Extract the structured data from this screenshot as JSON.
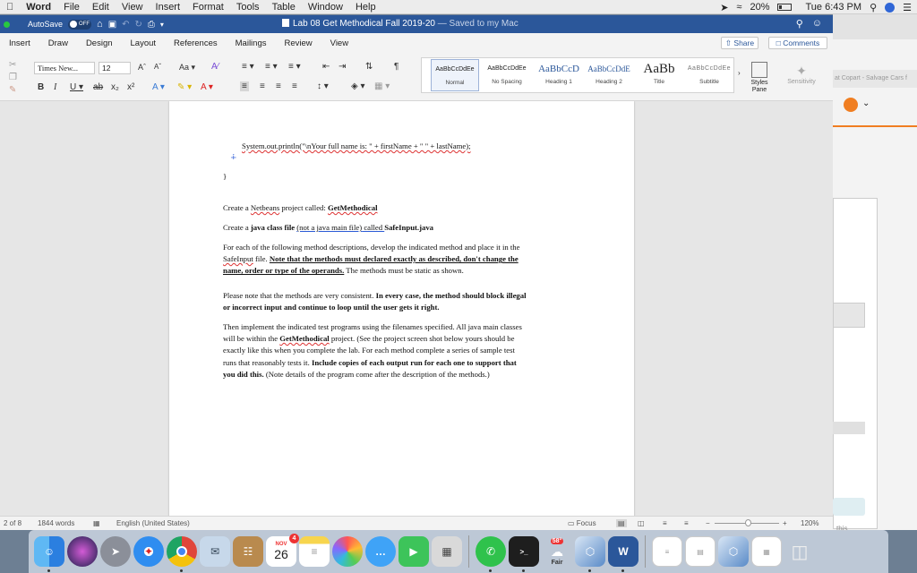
{
  "menubar": {
    "apple_icon": "apple-icon",
    "items": [
      "Word",
      "File",
      "Edit",
      "View",
      "Insert",
      "Format",
      "Tools",
      "Table",
      "Window",
      "Help"
    ],
    "battery": "20%",
    "clock": "Tue 6:43 PM"
  },
  "background_window": {
    "url_text": "at Copart - Salvage Cars f",
    "footer_text": "this"
  },
  "titlebar": {
    "autosave_label": "AutoSave",
    "autosave_state": "OFF",
    "doc_title": "Lab 08 Get Methodical Fall 2019-20",
    "saved_status": "— Saved to my Mac"
  },
  "tabs": [
    "Insert",
    "Draw",
    "Design",
    "Layout",
    "References",
    "Mailings",
    "Review",
    "View"
  ],
  "share_label": "Share",
  "comments_label": "Comments",
  "ribbon": {
    "font_name": "Times New...",
    "font_size": "12",
    "styles": [
      {
        "preview": "AaBbCcDdEe",
        "name": "Normal"
      },
      {
        "preview": "AaBbCcDdEe",
        "name": "No Spacing"
      },
      {
        "preview": "AaBbCcD",
        "name": "Heading 1"
      },
      {
        "preview": "AaBbCcDdE",
        "name": "Heading 2"
      },
      {
        "preview": "AaBb",
        "name": "Title"
      },
      {
        "preview": "AaBbCcDdEe",
        "name": "Subtitle"
      }
    ],
    "styles_pane_label": "Styles Pane",
    "sensitivity_label": "Sensitivity"
  },
  "document": {
    "code_line": "System.out.println(\"\\nYour full name is: \" + firstName + \" \" + lastName);",
    "brace": "}",
    "para1": {
      "pre": "Create a ",
      "netbeans": "Netbeans",
      " mid": " project called: ",
      "name": "GetMethodical"
    },
    "para2": {
      "pre": "Create a ",
      "java_class": "java class file",
      "space": " ",
      "paren": "(not a java main file)",
      "called": " called ",
      "file": "SafeInput.java"
    },
    "para3": {
      "l1": "For each of the following method descriptions, develop the indicated method and place it in the",
      "l2a": "SafeInput",
      "l2b": " file.  ",
      "l2c": "Note that the methods must declared exactly as described, don't change the",
      "l3a": "name, order or type of the operands.",
      "l3b": "  The methods must be static as shown."
    },
    "para4": {
      "l1a": "Please note that the methods are very consistent. ",
      "l1b": "In every case, the method should block illegal",
      "l2": "or incorrect input and continue to loop until the user gets it right."
    },
    "para5": {
      "l1": "Then implement the indicated test programs using the filenames specified.  All java main classes",
      "l2a": "will be within the ",
      "l2b": "GetMethodical",
      "l2c": " project. (See the project screen shot below yours should be",
      "l3": "exactly like this when you complete the lab. For each method complete a series of sample test",
      "l4a": "runs that reasonably tests it.  ",
      "l4b": "Include copies of each output run for each one to support that",
      "l5a": "you did this.",
      "l5b": "  (Note details of the program come after the description of the methods.)"
    }
  },
  "statusbar": {
    "page": "2 of 8",
    "words": "1844 words",
    "language": "English (United States)",
    "focus": "Focus",
    "zoom": "120%"
  },
  "dock": {
    "calendar_month": "NOV",
    "calendar_day": "26",
    "calendar_badge": "4",
    "weather_label": "Fair",
    "weather_temp": "58°",
    "word_letter": "W"
  },
  "colors": {
    "word_blue": "#2b579a",
    "spell_red": "#d33",
    "link_blue": "#2c5bd6"
  }
}
